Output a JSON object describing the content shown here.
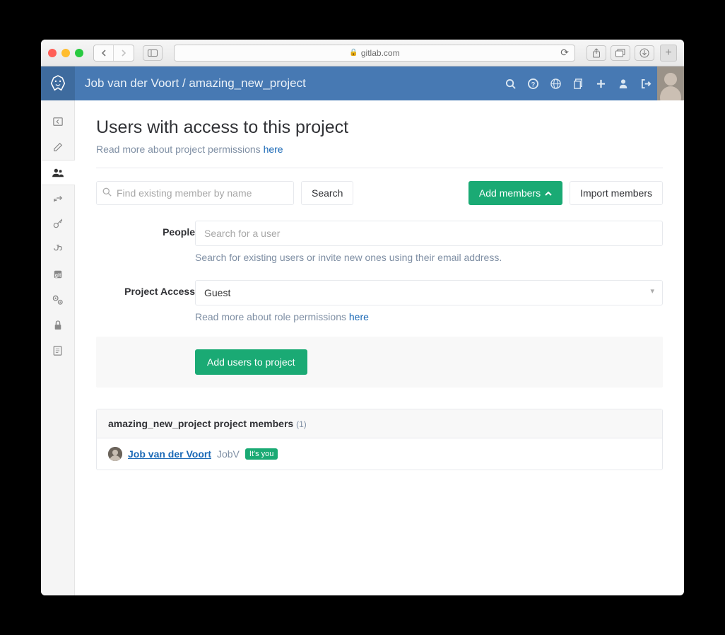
{
  "browser": {
    "url_host": "gitlab.com"
  },
  "header": {
    "breadcrumb": "Job van der Voort / amazing_new_project"
  },
  "page": {
    "title": "Users with access to this project",
    "perm_text": "Read more about project permissions ",
    "perm_link": "here"
  },
  "toolbar": {
    "search_placeholder": "Find existing member by name",
    "search_btn": "Search",
    "add_members": "Add members",
    "import_members": "Import members"
  },
  "form": {
    "people_label": "People",
    "people_placeholder": "Search for a user",
    "people_help": "Search for existing users or invite new ones using their email address.",
    "access_label": "Project Access",
    "access_value": "Guest",
    "access_help_prefix": "Read more about role permissions ",
    "access_help_link": "here",
    "submit": "Add users to project"
  },
  "members": {
    "header_prefix": "amazing_new_project project members ",
    "count_label": "(1)",
    "rows": [
      {
        "name": "Job van der Voort",
        "username": "JobV",
        "badge": "It's you"
      }
    ]
  }
}
